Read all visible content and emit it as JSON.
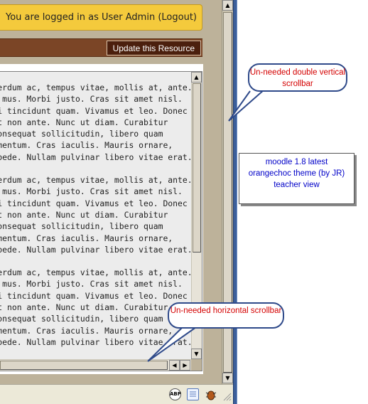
{
  "header": {
    "login_text": "You are logged in as User Admin (Logout)"
  },
  "toolbar": {
    "update_button_label": "Update this Resource"
  },
  "content": {
    "paragraphs": [
      {
        "lines": [
          "  interdum ac, tempus vitae, mollis at, ante.",
          "  lus mus. Morbi justo. Cras sit amet nisl.",
          "  orci tincidunt quam. Vivamus et leo. Donec",
          "  elit non ante. Nunc ut diam. Curabitur",
          "  n consequat sollicitudin, libero quam",
          "  ndimentum. Cras iaculis. Mauris ornare,",
          "  ac pede. Nullam pulvinar libero vitae erat."
        ]
      },
      {
        "lines": [
          "  interdum ac, tempus vitae, mollis at, ante.",
          "  lus mus. Morbi justo. Cras sit amet nisl.",
          "  orci tincidunt quam. Vivamus et leo. Donec",
          "  elit non ante. Nunc ut diam. Curabitur",
          "  n consequat sollicitudin, libero quam",
          "  ndimentum. Cras iaculis. Mauris ornare,",
          "  ac pede. Nullam pulvinar libero vitae erat."
        ]
      },
      {
        "lines": [
          "  interdum ac, tempus vitae, mollis at, ante.",
          "  lus mus. Morbi justo. Cras sit amet nisl.",
          "  orci tincidunt quam. Vivamus et leo. Donec",
          "  elit non ante. Nunc ut diam. Curabitur",
          "  n consequat sollicitudin, libero quam",
          "  ndimentum. Cras iaculis. Mauris ornare,",
          "  ac pede. Nullam pulvinar libero vitae erat."
        ]
      },
      {
        "lines": [
          "  interdum ac, tempus vitae, mollis at, ante."
        ]
      }
    ]
  },
  "annotations": {
    "double_scrollbar_note": "Un-needed double vertical scrollbar",
    "horizontal_scrollbar_note": "Un-needed horizontal scrollbar",
    "info_line1": "moodle 1.8 latest",
    "info_line2": "orangechoc theme (by JR)",
    "info_line3": "teacher view"
  },
  "statusbar": {
    "icons": [
      "abp-icon",
      "page-icon",
      "bug-icon"
    ]
  },
  "colors": {
    "login_bar": "#f4ca3c",
    "resource_bar": "#7b4526",
    "update_button": "#4b1f0d",
    "callout_text": "#d40000",
    "info_text": "#0000c8",
    "page_bg": "#bdb29a"
  },
  "glyphs": {
    "up": "▲",
    "down": "▼",
    "left": "◀",
    "right": "▶",
    "abp": "ABP"
  }
}
